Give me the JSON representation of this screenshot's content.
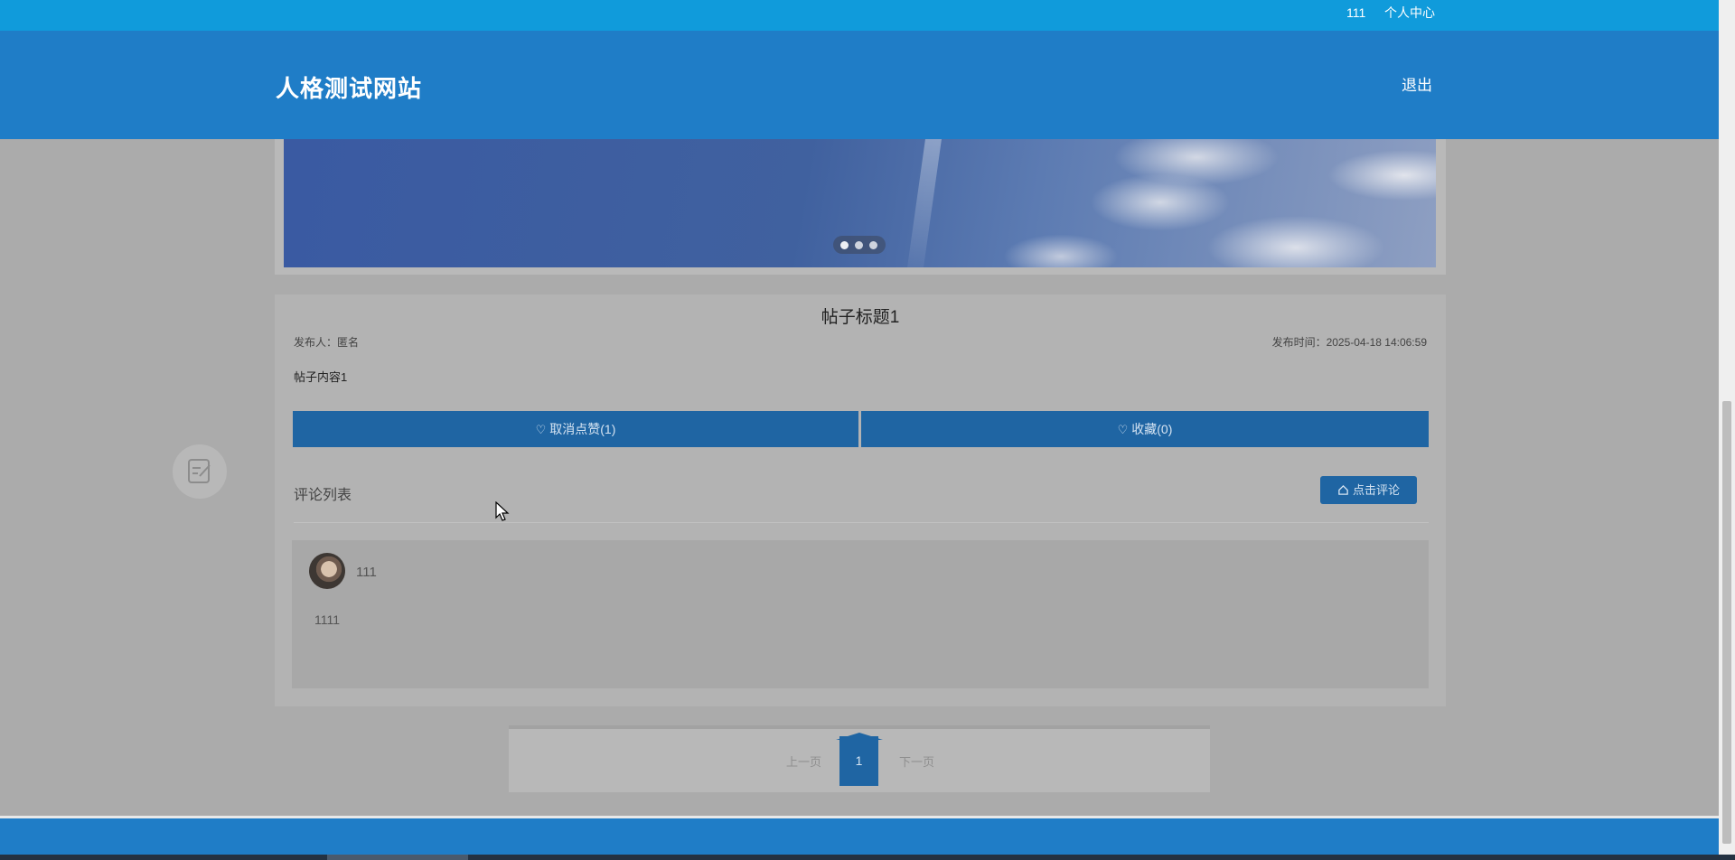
{
  "topbar": {
    "username": "111",
    "personal_center": "个人中心"
  },
  "header": {
    "site_title": "人格测试网站",
    "logout": "退出"
  },
  "banner": {
    "active_slide": 1,
    "slide_count": 3
  },
  "post": {
    "title": "帖子标题1",
    "author": "发布人：匿名",
    "publish_time": "发布时间：2025-04-18 14:06:59",
    "content": "帖子内容1",
    "like_button": "取消点赞(1)",
    "favorite_button": "收藏(0)"
  },
  "comments": {
    "section_label": "评论列表",
    "add_comment_button": "点击评论",
    "items": [
      {
        "user": "111",
        "text": "1111"
      }
    ]
  },
  "pagination": {
    "prev": "上一页",
    "current": "1",
    "next": "下一页"
  },
  "icons": {
    "like": "heart-icon",
    "favorite": "heart-icon",
    "comment": "home-icon",
    "side": "edit-note-icon"
  },
  "colors": {
    "topbar": "#109bdb",
    "header": "#1f7dc7",
    "button": "#1f65a3",
    "overlay_bg": "#ababab"
  }
}
